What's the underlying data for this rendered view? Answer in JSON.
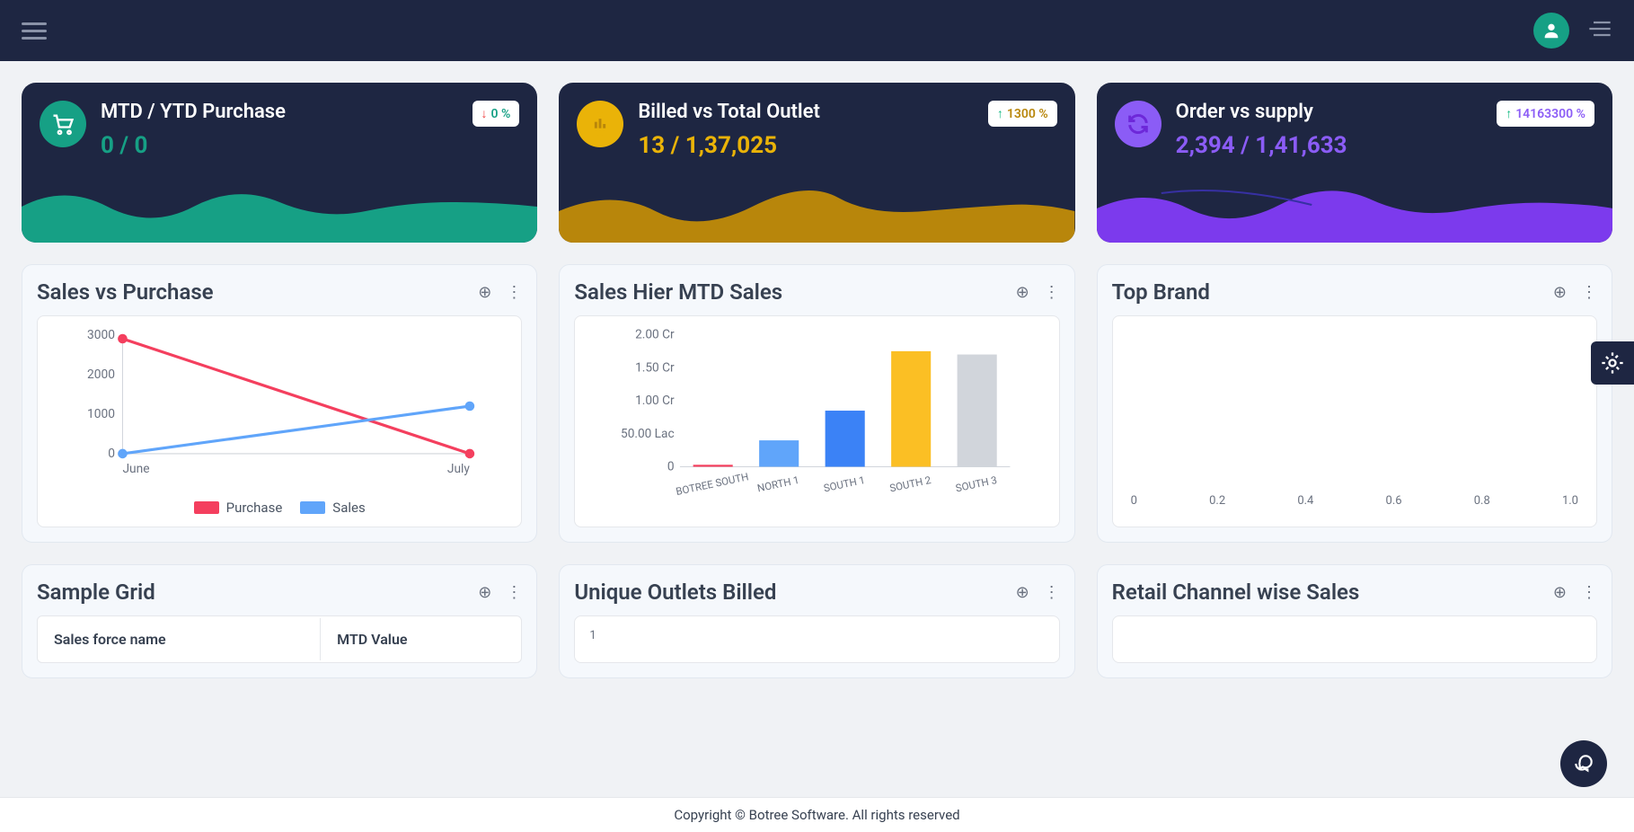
{
  "colors": {
    "teal": "#16a085",
    "gold": "#b8860b",
    "goldBright": "#eab308",
    "purple": "#8b5cf6",
    "pink": "#f43f5e",
    "blue": "#60a5fa",
    "gray": "#d1d5db"
  },
  "kpi": [
    {
      "title": "MTD / YTD Purchase",
      "value": "0 / 0",
      "badgeDir": "down",
      "badgeVal": "0 %",
      "badgeColorClass": "teal",
      "iconName": "cart-icon",
      "colorClass": "teal"
    },
    {
      "title": "Billed vs Total Outlet",
      "value": "13 / 1,37,025",
      "badgeDir": "up",
      "badgeVal": "1300 %",
      "badgeColorClass": "",
      "iconName": "bar-chart-icon",
      "colorClass": "gold"
    },
    {
      "title": "Order vs supply",
      "value": "2,394 / 1,41,633",
      "badgeDir": "up",
      "badgeVal": "14163300 %",
      "badgeColorClass": "purple",
      "iconName": "refresh-icon",
      "colorClass": "purple"
    }
  ],
  "panels": {
    "salesVsPurchase": {
      "title": "Sales vs Purchase"
    },
    "salesHier": {
      "title": "Sales Hier MTD Sales"
    },
    "topBrand": {
      "title": "Top Brand"
    },
    "sampleGrid": {
      "title": "Sample Grid"
    },
    "uniqueOutlets": {
      "title": "Unique Outlets Billed"
    },
    "retailChannel": {
      "title": "Retail Channel wise Sales"
    }
  },
  "grid": {
    "col1": "Sales force name",
    "col2": "MTD Value"
  },
  "footer": "Copyright © Botree Software. All rights reserved",
  "chart_data": [
    {
      "id": "sales_vs_purchase",
      "type": "line",
      "x": [
        "June",
        "July"
      ],
      "series": [
        {
          "name": "Purchase",
          "values": [
            2900,
            0
          ],
          "color": "#f43f5e"
        },
        {
          "name": "Sales",
          "values": [
            0,
            1200
          ],
          "color": "#60a5fa"
        }
      ],
      "yticks": [
        0,
        1000,
        2000,
        3000
      ],
      "ylim": [
        0,
        3000
      ]
    },
    {
      "id": "sales_hier",
      "type": "bar",
      "categories": [
        "BOTREE SOUTH",
        "NORTH 1",
        "SOUTH 1",
        "SOUTH 2",
        "SOUTH 3"
      ],
      "values": [
        300000,
        4000000,
        8500000,
        17500000,
        17000000
      ],
      "yticks": [
        "0",
        "50.00 Lac",
        "1.00 Cr",
        "1.50 Cr",
        "2.00 Cr"
      ],
      "ymax": 20000000,
      "colors": [
        "#f43f5e",
        "#60a5fa",
        "#3b82f6",
        "#fbbf24",
        "#d1d5db"
      ]
    },
    {
      "id": "top_brand",
      "type": "bar",
      "categories": [],
      "values": [],
      "xticks": [
        "0",
        "0.2",
        "0.4",
        "0.6",
        "0.8",
        "1.0"
      ]
    },
    {
      "id": "unique_outlets",
      "type": "bar",
      "categories": [],
      "values": [],
      "yticks": [
        "1"
      ]
    },
    {
      "id": "retail_channel",
      "type": "bar",
      "categories": [],
      "values": []
    }
  ]
}
